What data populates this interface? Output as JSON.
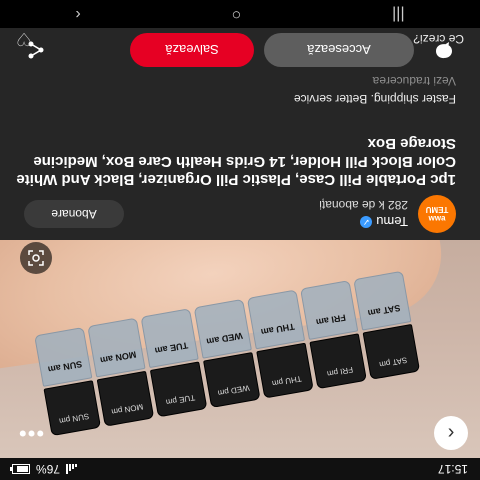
{
  "status": {
    "time": "15:17",
    "battery": "76%"
  },
  "product": {
    "lid_labels": [
      "SUN pm",
      "MON pm",
      "TUE pm",
      "WED pm",
      "THU pm",
      "FRI pm",
      "SAT pm"
    ],
    "box_labels": [
      "SUN am",
      "MON am",
      "TUE am",
      "WED am",
      "THU am",
      "FRI am",
      "SAT am"
    ]
  },
  "shop": {
    "logo_text": "TEMU",
    "logo_small": "ɐʍʍ",
    "name": "Temu",
    "followers": "282 k de abonați",
    "follow_label": "Abonare"
  },
  "pin": {
    "title": "1pc Portable Pill Case, Plastic Pill Organizer, Black And White Color Block Pill Holder, 14 Grids Health Care Box, Medicine Storage Box",
    "subtitle": "Faster shipping. Better service",
    "translate_label": "Vezi traducerea"
  },
  "actions": {
    "visit_label": "Accesează",
    "save_label": "Salvează"
  },
  "footer": {
    "question": "Ce crezi?"
  },
  "icons": {
    "back": "chevron-left-icon",
    "more": "ellipsis-icon",
    "lens": "visual-search-icon",
    "comment": "comment-icon",
    "share": "share-icon",
    "heart": "heart-icon"
  },
  "colors": {
    "save": "#e60023",
    "brand": "#fb7701",
    "background": "#262626"
  }
}
